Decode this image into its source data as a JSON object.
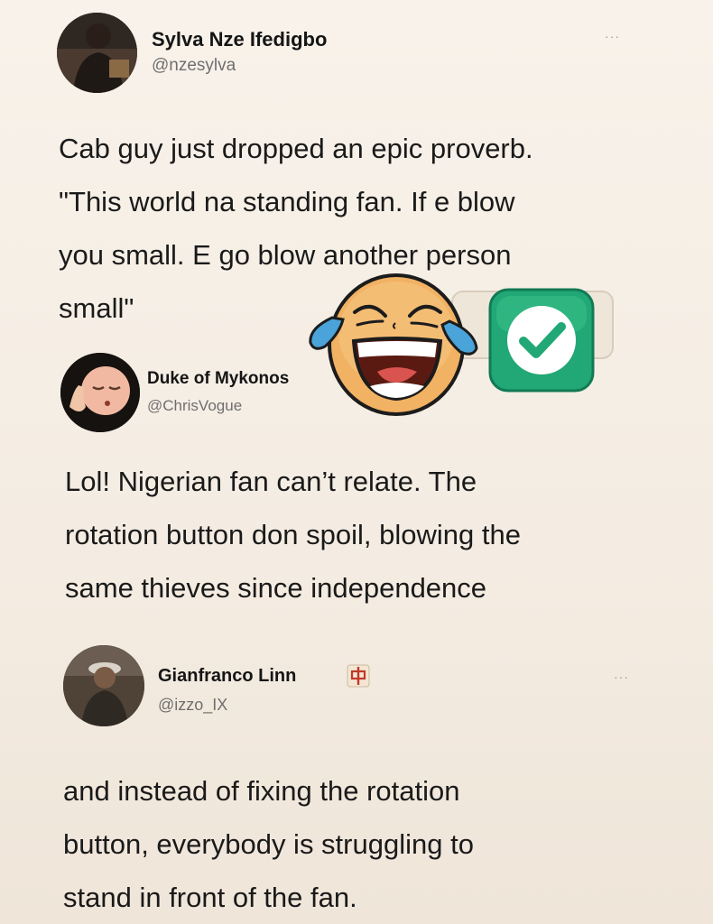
{
  "tweets": [
    {
      "name": "Sylva Nze Ifedigbo",
      "handle": "@nzesylva",
      "more": "···",
      "lines": [
        "Cab guy just dropped an epic proverb.",
        "\"This world na standing fan. If e blow",
        "you small. E go blow another person",
        "small\""
      ]
    },
    {
      "name": "Duke of Mykonos",
      "handle": "@ChrisVogue",
      "lines": [
        "Lol! Nigerian fan can’t relate. The",
        "rotation button don spoil, blowing the",
        "same thieves since independence"
      ]
    },
    {
      "name": "Gianfranco Linn",
      "handle": "@izzo_IX",
      "more": "···",
      "lines": [
        "and instead of fixing the rotation",
        "button, everybody is struggling to",
        "stand in front of the fan."
      ]
    }
  ],
  "stickers": {
    "laughing": "face-with-tears-of-joy-icon",
    "check": "check-mark-button-icon",
    "colors": {
      "check_bg": "#21a876",
      "emoji_face": "#f1b264",
      "tear": "#4aa3d9"
    }
  }
}
